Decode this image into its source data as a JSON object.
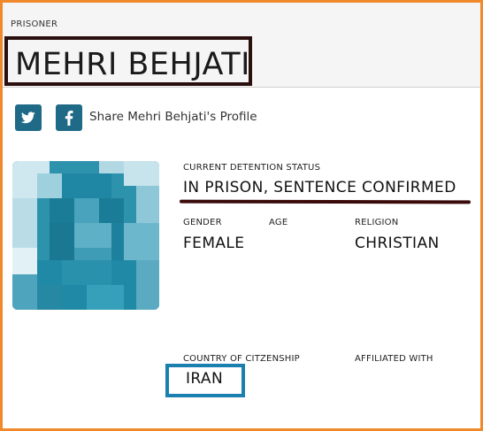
{
  "header": {
    "kicker": "PRISONER",
    "name": "MEHRI BEHJATI"
  },
  "share": {
    "twitter_icon": "twitter-icon",
    "facebook_icon": "facebook-icon",
    "label": "Share Mehri Behjati's Profile"
  },
  "profile": {
    "status_label": "CURRENT DETENTION STATUS",
    "status_value": "IN PRISON, SENTENCE CONFIRMED",
    "gender_label": "GENDER",
    "gender_value": "FEMALE",
    "age_label": "AGE",
    "religion_label": "RELIGION",
    "religion_value": "CHRISTIAN",
    "country_label": "COUNTRY OF CITZENSHIP",
    "country_value": "IRAN",
    "affiliated_label": "AFFILIATED WITH"
  },
  "colors": {
    "accent": "#1f6a86",
    "frame": "#f0892c",
    "highlight_box": "#2a0f0f",
    "country_box": "#1b7fb0"
  }
}
